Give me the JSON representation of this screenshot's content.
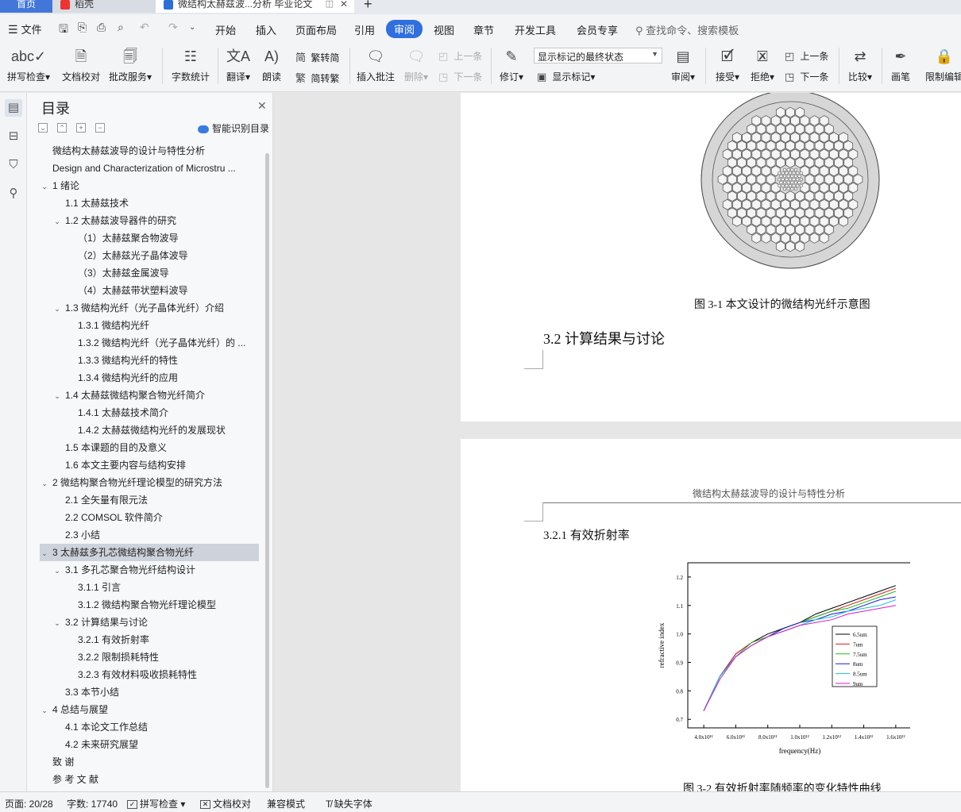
{
  "tabs": {
    "home": "首页",
    "daoke": "稻壳",
    "doc": "微结构太赫兹波...分析 毕业论文",
    "new_tab": "+"
  },
  "menu": {
    "file": "文件",
    "items": [
      "开始",
      "插入",
      "页面布局",
      "引用",
      "审阅",
      "视图",
      "章节",
      "开发工具",
      "会员专享"
    ],
    "active": "审阅",
    "search": "查找命令、搜索模板"
  },
  "ribbon": {
    "spell_check": "拼写检查",
    "doc_proof": "文档校对",
    "correction_service": "批改服务",
    "word_count": "字数统计",
    "translate": "翻译",
    "read_aloud": "朗读",
    "to_traditional": "繁转简",
    "to_simplified": "简转繁",
    "insert_comment": "插入批注",
    "delete": "删除",
    "prev_comment": "上一条",
    "next_comment": "下一条",
    "revise": "修订",
    "markup_state": "显示标记的最终状态",
    "show_markup": "显示标记",
    "review": "审阅",
    "accept": "接受",
    "reject": "拒绝",
    "prev_change": "上一条",
    "next_change": "下一条",
    "compare": "比较",
    "pen": "画笔",
    "restrict_edit": "限制编辑"
  },
  "toc": {
    "title": "目录",
    "smart_recognize": "智能识别目录",
    "items": [
      {
        "label": "微结构太赫兹波导的设计与特性分析",
        "level": 0,
        "toggle": ""
      },
      {
        "label": "Design and Characterization of Microstru ...",
        "level": 0,
        "toggle": ""
      },
      {
        "label": "1  绪论",
        "level": 0,
        "toggle": "v"
      },
      {
        "label": "1.1  太赫兹技术",
        "level": 1,
        "toggle": ""
      },
      {
        "label": "1.2  太赫兹波导器件的研究",
        "level": 1,
        "toggle": "v"
      },
      {
        "label": "（1）太赫兹聚合物波导",
        "level": 2,
        "toggle": ""
      },
      {
        "label": "（2）太赫兹光子晶体波导",
        "level": 2,
        "toggle": ""
      },
      {
        "label": "（3）太赫兹金属波导",
        "level": 2,
        "toggle": ""
      },
      {
        "label": "（4）太赫兹带状塑料波导",
        "level": 2,
        "toggle": ""
      },
      {
        "label": "1.3  微结构光纤（光子晶体光纤）介绍",
        "level": 1,
        "toggle": "v"
      },
      {
        "label": "1.3.1  微结构光纤",
        "level": 2,
        "toggle": ""
      },
      {
        "label": "1.3.2  微结构光纤（光子晶体光纤）的 ...",
        "level": 2,
        "toggle": ""
      },
      {
        "label": "1.3.3  微结构光纤的特性",
        "level": 2,
        "toggle": ""
      },
      {
        "label": "1.3.4  微结构光纤的应用",
        "level": 2,
        "toggle": ""
      },
      {
        "label": "1.4  太赫兹微结构聚合物光纤简介",
        "level": 1,
        "toggle": "v"
      },
      {
        "label": "1.4.1  太赫兹技术简介",
        "level": 2,
        "toggle": ""
      },
      {
        "label": "1.4.2  太赫兹微结构光纤的发展现状",
        "level": 2,
        "toggle": ""
      },
      {
        "label": "1.5  本课题的目的及意义",
        "level": 1,
        "toggle": ""
      },
      {
        "label": "1.6  本文主要内容与结构安排",
        "level": 1,
        "toggle": ""
      },
      {
        "label": "2  微结构聚合物光纤理论模型的研究方法",
        "level": 0,
        "toggle": "v"
      },
      {
        "label": "2.1  全矢量有限元法",
        "level": 1,
        "toggle": ""
      },
      {
        "label": "2.2 COMSOL 软件简介",
        "level": 1,
        "toggle": ""
      },
      {
        "label": "2.3  小结",
        "level": 1,
        "toggle": ""
      },
      {
        "label": "3  太赫兹多孔芯微结构聚合物光纤",
        "level": 0,
        "toggle": "v",
        "selected": true
      },
      {
        "label": "3.1  多孔芯聚合物光纤结构设计",
        "level": 1,
        "toggle": "v"
      },
      {
        "label": "3.1.1  引言",
        "level": 2,
        "toggle": ""
      },
      {
        "label": "3.1.2  微结构聚合物光纤理论模型",
        "level": 2,
        "toggle": ""
      },
      {
        "label": "3.2  计算结果与讨论",
        "level": 1,
        "toggle": "v"
      },
      {
        "label": "3.2.1  有效折射率",
        "level": 2,
        "toggle": ""
      },
      {
        "label": "3.2.2  限制损耗特性",
        "level": 2,
        "toggle": ""
      },
      {
        "label": "3.2.3  有效材料吸收损耗特性",
        "level": 2,
        "toggle": ""
      },
      {
        "label": "3.3  本节小结",
        "level": 1,
        "toggle": ""
      },
      {
        "label": "4  总结与展望",
        "level": 0,
        "toggle": "v"
      },
      {
        "label": "4.1  本论文工作总结",
        "level": 1,
        "toggle": ""
      },
      {
        "label": "4.2  未来研究展望",
        "level": 1,
        "toggle": ""
      },
      {
        "label": "致  谢",
        "level": 0,
        "toggle": ""
      },
      {
        "label": "参 考 文 献",
        "level": 0,
        "toggle": ""
      }
    ]
  },
  "document": {
    "fig1_caption": "图 3-1  本文设计的微结构光纤示意图",
    "section_32": "3.2  计算结果与讨论",
    "running_header": "微结构太赫兹波导的设计与特性分析",
    "section_321": "3.2.1  有效折射率",
    "fig2_caption": "图 3-2  有效折射率随频率的变化特性曲线"
  },
  "chart_data": {
    "type": "line",
    "xlabel": "frequency(Hz)",
    "ylabel": "refractive index",
    "x_ticks": [
      "4.0x10¹¹",
      "6.0x10¹¹",
      "8.0x10¹¹",
      "1.0x10¹²",
      "1.2x10¹²",
      "1.4x10¹²",
      "1.6x10¹²"
    ],
    "y_ticks": [
      "0.7",
      "0.8",
      "0.9",
      "1.0",
      "1.1",
      "1.2"
    ],
    "xlim": [
      300000000000.0,
      1700000000000.0
    ],
    "ylim": [
      0.67,
      1.25
    ],
    "legend_position": "right",
    "x": [
      400000000000.0,
      500000000000.0,
      600000000000.0,
      700000000000.0,
      800000000000.0,
      900000000000.0,
      1000000000000.0,
      1100000000000.0,
      1200000000000.0,
      1300000000000.0,
      1400000000000.0,
      1500000000000.0,
      1600000000000.0
    ],
    "series": [
      {
        "name": "6.5um",
        "color": "#000000",
        "values": [
          0.73,
          0.85,
          0.93,
          0.97,
          1.0,
          1.02,
          1.04,
          1.07,
          1.09,
          1.11,
          1.13,
          1.15,
          1.17
        ]
      },
      {
        "name": "7um",
        "color": "#d42020",
        "values": [
          0.73,
          0.85,
          0.93,
          0.97,
          0.99,
          1.02,
          1.04,
          1.06,
          1.08,
          1.1,
          1.12,
          1.14,
          1.16
        ]
      },
      {
        "name": "7.5um",
        "color": "#1fbf1f",
        "values": [
          0.73,
          0.85,
          0.92,
          0.97,
          0.99,
          1.02,
          1.04,
          1.06,
          1.08,
          1.09,
          1.11,
          1.13,
          1.15
        ]
      },
      {
        "name": "8um",
        "color": "#1a1ad4",
        "values": [
          0.73,
          0.85,
          0.92,
          0.96,
          0.99,
          1.02,
          1.04,
          1.05,
          1.07,
          1.08,
          1.1,
          1.12,
          1.13
        ]
      },
      {
        "name": "8.5um",
        "color": "#19c2d8",
        "values": [
          0.73,
          0.85,
          0.92,
          0.96,
          0.99,
          1.01,
          1.03,
          1.05,
          1.06,
          1.08,
          1.09,
          1.1,
          1.12
        ]
      },
      {
        "name": "9um",
        "color": "#d41ad4",
        "values": [
          0.73,
          0.84,
          0.92,
          0.96,
          0.99,
          1.01,
          1.03,
          1.04,
          1.05,
          1.07,
          1.08,
          1.09,
          1.1
        ]
      }
    ]
  },
  "status": {
    "page": "页面: 20/28",
    "word_count": "字数: 17740",
    "spell_check": "拼写检查",
    "doc_proof": "文档校对",
    "compat_mode": "兼容模式",
    "missing_font": "缺失字体"
  }
}
